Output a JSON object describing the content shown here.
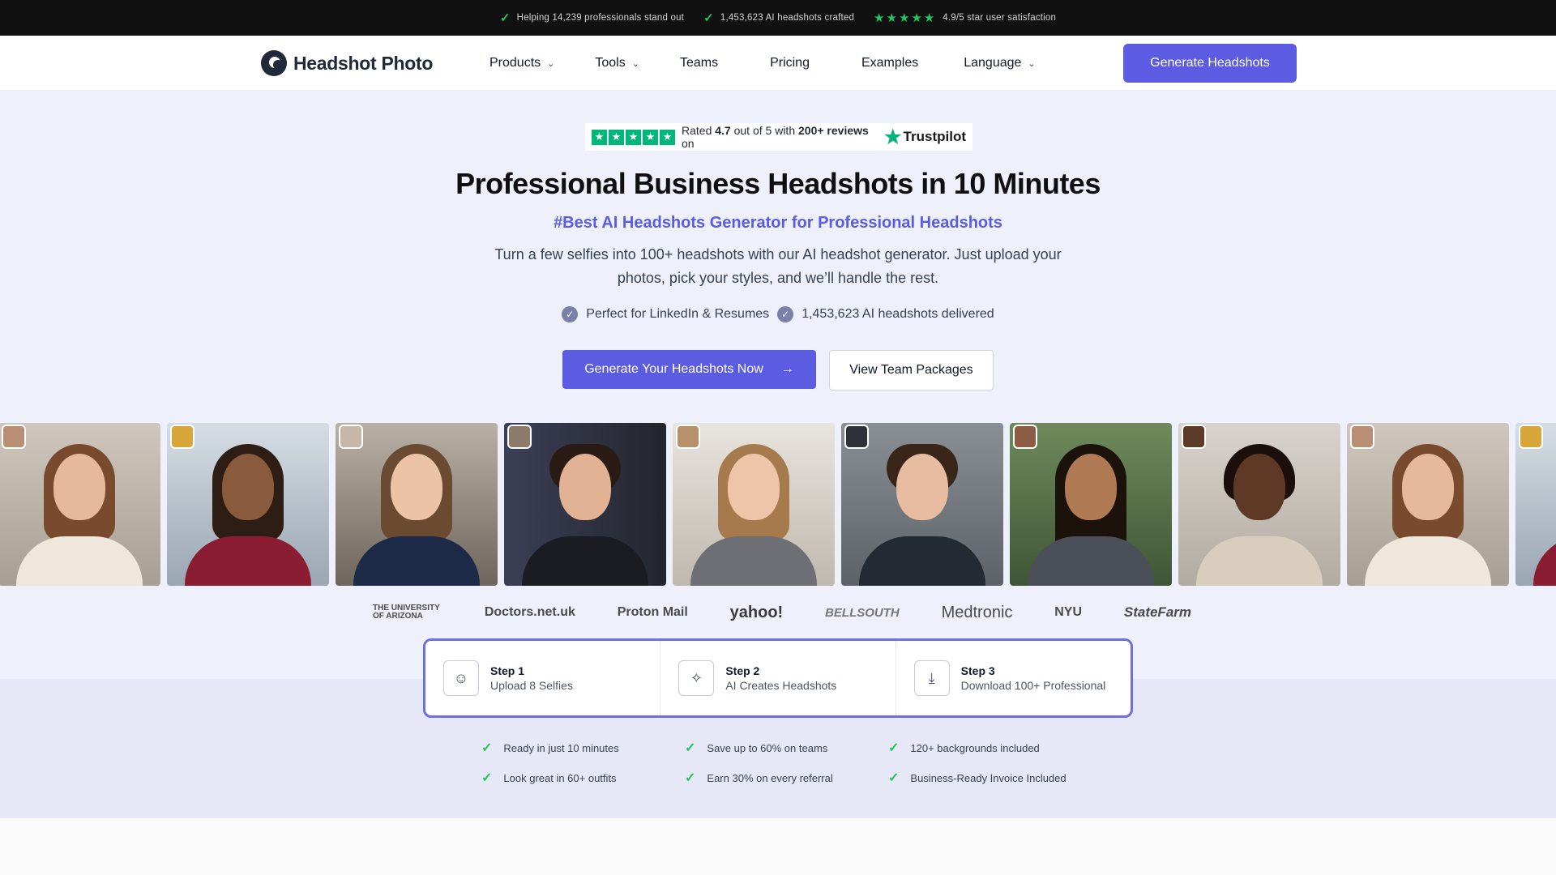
{
  "topbar": {
    "items": [
      "Helping 14,239 professionals stand out",
      "1,453,623 AI headshots crafted",
      "4.9/5 star user satisfaction"
    ],
    "stars": "★★★★★"
  },
  "nav": {
    "logo": "Headshot Photo",
    "links": [
      "Products",
      "Tools",
      "Teams",
      "Pricing",
      "Examples",
      "Language"
    ],
    "cta": "Generate Headshots"
  },
  "trustpilot": {
    "rated": "Rated",
    "score": "4.7",
    "out_of": "out of 5 with",
    "reviews": "200+ reviews",
    "on": "on",
    "brand": "Trustpilot"
  },
  "hero": {
    "title": "Professional Business Headshots in 10 Minutes",
    "tagline": "#Best AI Headshots Generator for Professional Headshots",
    "description": "Turn a few selfies into 100+ headshots with our AI headshot generator. Just upload your photos, pick your styles, and we’ll handle the rest.",
    "bullets": [
      "Perfect for LinkedIn & Resumes",
      "1,453,623 AI headshots delivered"
    ],
    "cta_primary": "Generate Your Headshots Now",
    "cta_secondary": "View Team Packages"
  },
  "logos": [
    "THE UNIVERSITY OF ARIZONA",
    "Doctors.net.uk",
    "Proton Mail",
    "yahoo!",
    "BELLSOUTH",
    "Medtronic",
    "NYU",
    "StateFarm"
  ],
  "steps": [
    {
      "title": "Step 1",
      "desc": "Upload 8 Selfies",
      "icon": "smiley-icon"
    },
    {
      "title": "Step 2",
      "desc": "AI Creates Headshots",
      "icon": "sparkle-icon"
    },
    {
      "title": "Step 3",
      "desc": "Download 100+ Professional",
      "icon": "download-icon"
    }
  ],
  "features": [
    "Ready in just 10 minutes",
    "Save up to 60% on teams",
    "120+ backgrounds included",
    "Look great in 60+ outfits",
    "Earn 30% on every referral",
    "Business-Ready Invoice Included"
  ],
  "colors": {
    "accent": "#5b5ce2",
    "trustpilot_green": "#00b67a",
    "check_green": "#22c55e",
    "topbar_bg": "#111111",
    "hero_bg": "#eef0fb"
  }
}
